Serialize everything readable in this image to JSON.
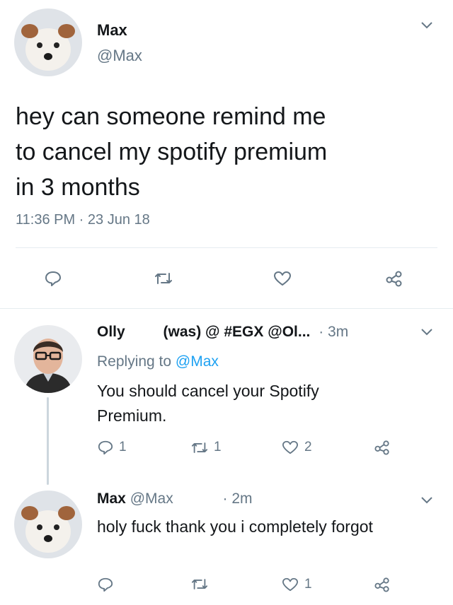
{
  "main_tweet": {
    "author_name": "Max",
    "handle": "@Max",
    "text_lines": [
      "hey can someone remind me",
      "to cancel my spotify premium",
      "in 3 months"
    ],
    "timestamp": "11:36 PM · 23 Jun 18"
  },
  "reply1": {
    "author_name": "Olly",
    "author_suffix": "(was) @ #EGX @Ol...",
    "time": "· 3m",
    "replying_prefix": "Replying to",
    "replying_handle": "@Max",
    "text_lines": [
      "You should cancel your Spotify",
      "Premium."
    ],
    "reply_count": "1",
    "retweet_count": "1",
    "like_count": "2"
  },
  "reply2": {
    "author_name": "Max",
    "handle": "@Max",
    "time": "· 2m",
    "text": "holy fuck thank you i completely forgot",
    "like_count": "1"
  },
  "colors": {
    "text": "#14171a",
    "muted": "#657786",
    "link": "#1da1f2",
    "divider": "#e6ecf0"
  },
  "icons": [
    "chevron-down-icon",
    "reply-icon",
    "retweet-icon",
    "like-icon",
    "share-icon"
  ]
}
